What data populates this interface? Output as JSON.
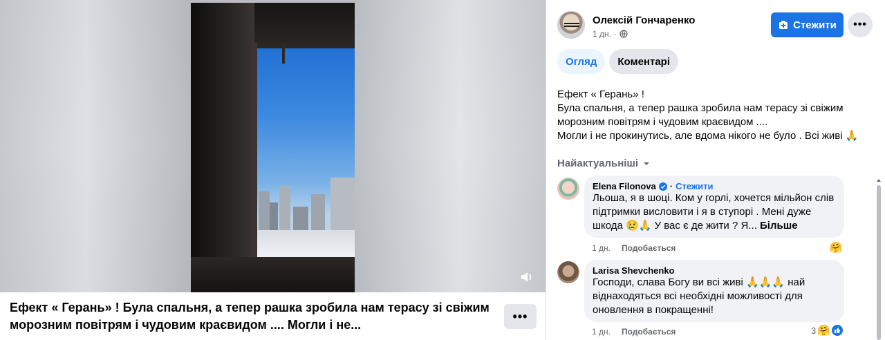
{
  "post": {
    "author": "Олексій Гончаренко",
    "time": "1 дн.",
    "audience_icon": "globe-icon",
    "follow_label": "Стежити",
    "more_label": "•••",
    "text_lines": [
      "Ефект « Герань» !",
      "Була спальня, а тепер рашка зробила нам терасу зі свіжим морозним повітрям і чудовим краєвидом ....",
      "Могли і не прокинутись, але вдома нікого не було . Всі живі 🙏"
    ],
    "caption": "Ефект « Герань» ! Була спальня, а тепер рашка зробила нам терасу зі свіжим морозним повітрям і чудовим краєвидом .... Могли і не...",
    "caption_more_label": "•••"
  },
  "tabs": [
    {
      "label": "Огляд",
      "active": true
    },
    {
      "label": "Коментарі",
      "active": false
    }
  ],
  "sort_label": "Найактуальніші",
  "comments": [
    {
      "name": "Elena Filonova",
      "verified": true,
      "follow_label": "Стежити",
      "text": "Льоша, я в шоці. Ком у горлі, хочется мільйон слів підтримки висловити і я в ступорі . Мені дуже шкода 😢🙏 У вас є де жити ? Я...",
      "more_label": "Більше",
      "time": "1 дн.",
      "reply_label": "Подобається",
      "reactions_count": ""
    },
    {
      "name": "Larisa Shevchenko",
      "verified": false,
      "follow_label": "",
      "text": "Господи, слава Богу ви всі живі 🙏🙏🙏 най віднаходяться всі необхідні можливості для оновлення в покращенні!",
      "more_label": "",
      "time": "1 дн.",
      "reply_label": "Подобається",
      "reactions_count": "3"
    }
  ],
  "colors": {
    "accent": "#1b74e4",
    "secondary_text": "#65676b",
    "bubble": "#f0f2f5"
  }
}
